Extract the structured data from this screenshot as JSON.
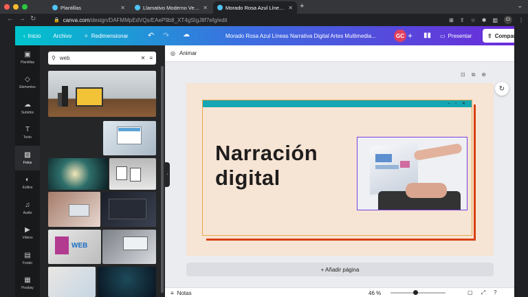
{
  "browser": {
    "tabs": [
      {
        "title": "Plantillas",
        "active": false
      },
      {
        "title": "Llamativo Moderno Verde Roj...",
        "active": false
      },
      {
        "title": "Morado Rosa Azul Líneas Narr...",
        "active": true
      }
    ],
    "close_glyph": "✕",
    "new_tab": "+",
    "tab_menu": "⌄",
    "url_host": "canva.com",
    "url_path": "/design/DAFMMpEdVQs/EAeP9b8_XT4gSIgJ8f7efg/edit",
    "profile": "CI"
  },
  "toolbar": {
    "home": "Inicio",
    "file": "Archivo",
    "resize": "Redimensionar",
    "doc_title": "Morado Rosa Azul Líneas Narrativa Digital Artes Multimedia...",
    "avatar": "GC",
    "present": "Presentar",
    "share": "Compartir"
  },
  "rail": [
    {
      "label": "Plantillas",
      "icon": "templates-icon",
      "glyph": "▣"
    },
    {
      "label": "Elementos",
      "icon": "elements-icon",
      "glyph": "◇"
    },
    {
      "label": "Subidos",
      "icon": "upload-icon",
      "glyph": "☁"
    },
    {
      "label": "Texto",
      "icon": "text-icon",
      "glyph": "T"
    },
    {
      "label": "Fotos",
      "icon": "photos-icon",
      "glyph": "▨"
    },
    {
      "label": "Estilos",
      "icon": "styles-icon",
      "glyph": "◐"
    },
    {
      "label": "Audio",
      "icon": "audio-icon",
      "glyph": "♫"
    },
    {
      "label": "Videos",
      "icon": "video-icon",
      "glyph": "▶"
    },
    {
      "label": "Fondo",
      "icon": "background-icon",
      "glyph": "▤"
    },
    {
      "label": "Pixabay",
      "icon": "pixabay-icon",
      "glyph": "▦"
    }
  ],
  "rail_active": "Fotos",
  "search": {
    "value": "web",
    "placeholder": ""
  },
  "editor": {
    "animate": "Animar",
    "headline_line1": "Narración",
    "headline_line2": "digital",
    "add_page": "+ Añadir página",
    "notes": "Notas",
    "zoom": "46 %",
    "zoom_fraction": 0.46
  },
  "colors": {
    "brand_gradient_start": "#00c4cc",
    "brand_gradient_end": "#6b2bd9",
    "slide_bg": "#f6e4d4",
    "window_header": "#14a6b2",
    "window_shadow": "#d9400f",
    "selection": "#7b3fe4"
  }
}
